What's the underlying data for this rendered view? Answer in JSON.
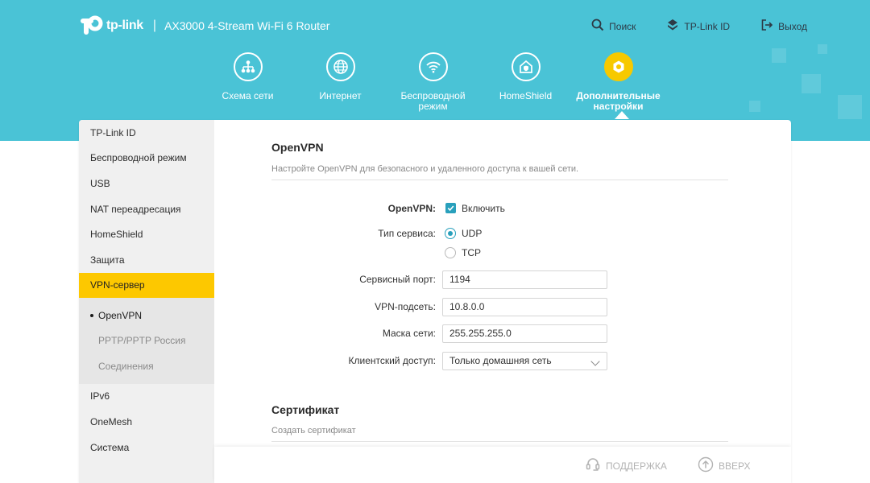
{
  "header": {
    "logo_text": "tp-link",
    "separator": "|",
    "model": "AX3000 4-Stream Wi-Fi 6 Router",
    "search_label": "Поиск",
    "tplink_id_label": "TP-Link ID",
    "logout_label": "Выход"
  },
  "nav": {
    "items": [
      {
        "label": "Схема сети",
        "icon": "network-map-icon"
      },
      {
        "label": "Интернет",
        "icon": "globe-icon"
      },
      {
        "label": "Беспроводной режим",
        "icon": "wifi-icon"
      },
      {
        "label": "HomeShield",
        "icon": "home-shield-icon"
      },
      {
        "label": "Дополнительные настройки",
        "icon": "gear-icon",
        "active": true
      }
    ]
  },
  "sidebar": {
    "items": [
      {
        "label": "TP-Link ID"
      },
      {
        "label": "Беспроводной режим"
      },
      {
        "label": "USB"
      },
      {
        "label": "NAT переадресация"
      },
      {
        "label": "HomeShield"
      },
      {
        "label": "Защита"
      },
      {
        "label": "VPN-сервер",
        "active": true
      }
    ],
    "subitems": [
      {
        "label": "OpenVPN",
        "current": true
      },
      {
        "label": "PPTP/PPTP Россия"
      },
      {
        "label": "Соединения"
      }
    ],
    "items_after": [
      {
        "label": "IPv6"
      },
      {
        "label": "OneMesh"
      },
      {
        "label": "Система"
      }
    ]
  },
  "openvpn": {
    "title": "OpenVPN",
    "description": "Настройте OpenVPN для безопасного и удаленного доступа к вашей сети.",
    "enable_label": "OpenVPN:",
    "enable_option": "Включить",
    "enabled": true,
    "service_type_label": "Тип сервиса:",
    "service_options": [
      "UDP",
      "TCP"
    ],
    "service_selected": "UDP",
    "port_label": "Сервисный порт:",
    "port_value": "1194",
    "subnet_label": "VPN-подсеть:",
    "subnet_value": "10.8.0.0",
    "mask_label": "Маска сети:",
    "mask_value": "255.255.255.0",
    "client_access_label": "Клиентский доступ:",
    "client_access_value": "Только домашняя сеть"
  },
  "certificate": {
    "title": "Сертификат",
    "description": "Создать сертификат"
  },
  "footer": {
    "support_label": "ПОДДЕРЖКА",
    "top_label": "ВВЕРХ"
  },
  "colors": {
    "header_bg": "#4ac3d6",
    "accent_yellow": "#fdc800",
    "control_blue": "#29a0bc"
  }
}
